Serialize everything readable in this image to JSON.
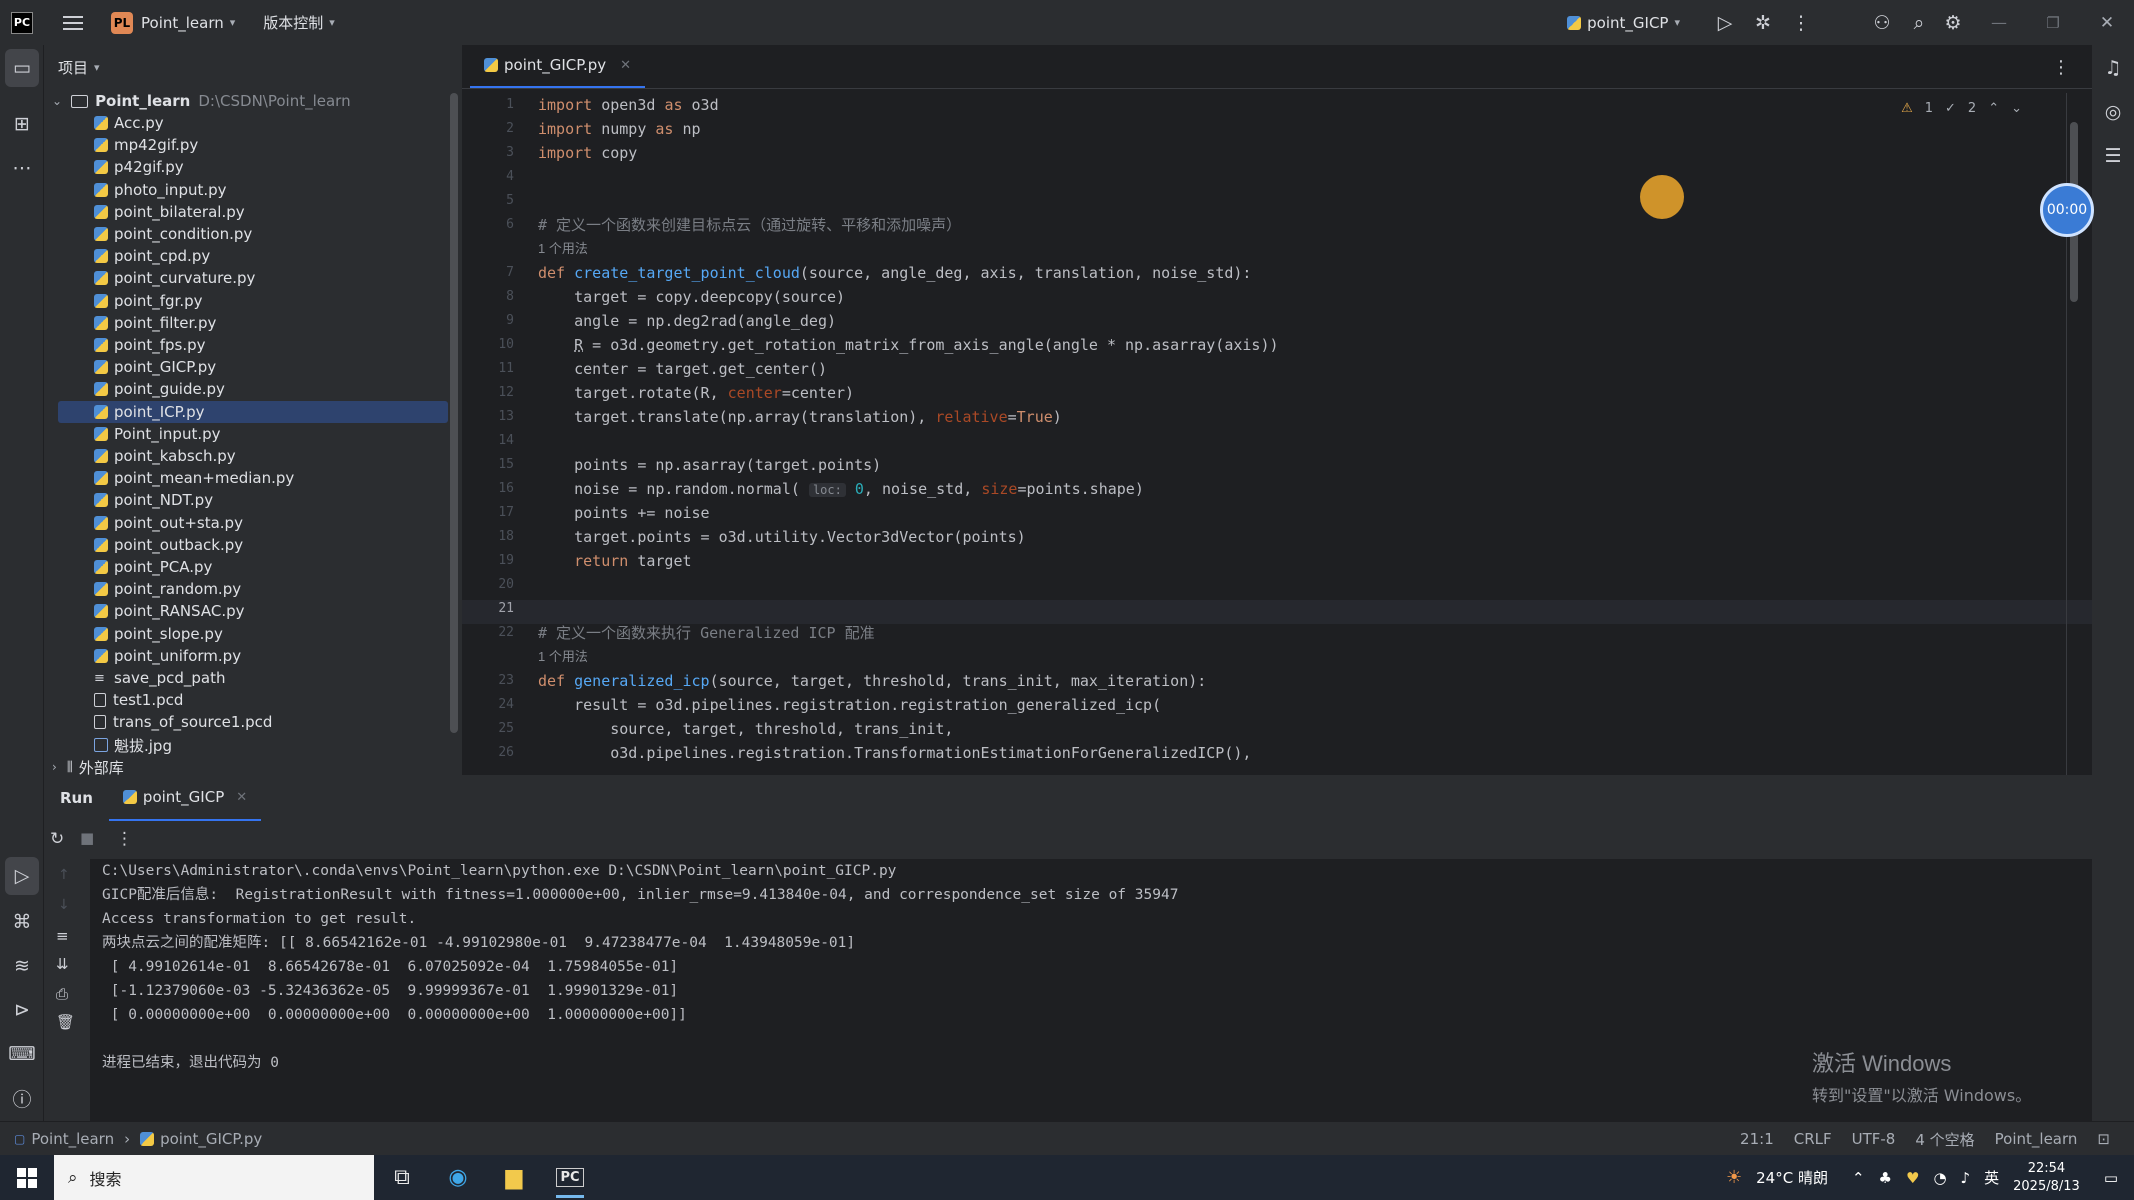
{
  "titlebar": {
    "project_initials": "PL",
    "project_name": "Point_learn",
    "vcs_menu": "版本控制",
    "run_config": "point_GICP"
  },
  "project_panel": {
    "header": "项目",
    "root_name": "Point_learn",
    "root_path": "D:\\CSDN\\Point_learn",
    "files": [
      {
        "name": "Acc.py",
        "kind": "py"
      },
      {
        "name": "mp42gif.py",
        "kind": "py"
      },
      {
        "name": "p42gif.py",
        "kind": "py"
      },
      {
        "name": "photo_input.py",
        "kind": "py"
      },
      {
        "name": "point_bilateral.py",
        "kind": "py"
      },
      {
        "name": "point_condition.py",
        "kind": "py"
      },
      {
        "name": "point_cpd.py",
        "kind": "py"
      },
      {
        "name": "point_curvature.py",
        "kind": "py"
      },
      {
        "name": "point_fgr.py",
        "kind": "py"
      },
      {
        "name": "point_filter.py",
        "kind": "py"
      },
      {
        "name": "point_fps.py",
        "kind": "py"
      },
      {
        "name": "point_GICP.py",
        "kind": "py"
      },
      {
        "name": "point_guide.py",
        "kind": "py"
      },
      {
        "name": "point_ICP.py",
        "kind": "py",
        "selected": true
      },
      {
        "name": "Point_input.py",
        "kind": "py"
      },
      {
        "name": "point_kabsch.py",
        "kind": "py"
      },
      {
        "name": "point_mean+median.py",
        "kind": "py"
      },
      {
        "name": "point_NDT.py",
        "kind": "py"
      },
      {
        "name": "point_out+sta.py",
        "kind": "py"
      },
      {
        "name": "point_outback.py",
        "kind": "py"
      },
      {
        "name": "point_PCA.py",
        "kind": "py"
      },
      {
        "name": "point_random.py",
        "kind": "py"
      },
      {
        "name": "point_RANSAC.py",
        "kind": "py"
      },
      {
        "name": "point_slope.py",
        "kind": "py"
      },
      {
        "name": "point_uniform.py",
        "kind": "py"
      },
      {
        "name": "save_pcd_path",
        "kind": "lines"
      },
      {
        "name": "test1.pcd",
        "kind": "txt"
      },
      {
        "name": "trans_of_source1.pcd",
        "kind": "txt"
      },
      {
        "name": "魁拔.jpg",
        "kind": "img"
      }
    ],
    "external_libs": "外部库"
  },
  "editor": {
    "tab_label": "point_GICP.py",
    "inspections": {
      "warnings": "1",
      "ok": "2"
    },
    "current_line": "21"
  },
  "run_panel": {
    "run_label": "Run",
    "tab_label": "point_GICP",
    "console": [
      "C:\\Users\\Administrator\\.conda\\envs\\Point_learn\\python.exe D:\\CSDN\\Point_learn\\point_GICP.py",
      "GICP配准后信息:  RegistrationResult with fitness=1.000000e+00, inlier_rmse=9.413840e-04, and correspondence_set size of 35947",
      "Access transformation to get result.",
      "两块点云之间的配准矩阵: [[ 8.66542162e-01 -4.99102980e-01  9.47238477e-04  1.43948059e-01]",
      " [ 4.99102614e-01  8.66542678e-01  6.07025092e-04  1.75984055e-01]",
      " [-1.12379060e-03 -5.32436362e-05  9.99999367e-01  1.99901329e-01]",
      " [ 0.00000000e+00  0.00000000e+00  0.00000000e+00  1.00000000e+00]]",
      "",
      "进程已结束，退出代码为 0"
    ],
    "watermark_title": "激活 Windows",
    "watermark_sub": "转到\"设置\"以激活 Windows。"
  },
  "timer": "00:00",
  "statusbar": {
    "crumb_project": "Point_learn",
    "crumb_file": "point_GICP.py",
    "position": "21:1",
    "line_sep": "CRLF",
    "encoding": "UTF-8",
    "indent": "4 个空格",
    "interpreter": "Point_learn"
  },
  "taskbar": {
    "search_placeholder": "搜索",
    "weather": "24°C 晴朗",
    "ime": "英",
    "time": "22:54",
    "date": "2025/8/13"
  },
  "colors": {
    "accent": "#3574f0",
    "keyword": "#cf8e6d",
    "function": "#56a8f5",
    "comment": "#7a7e85",
    "number": "#2aacb8"
  }
}
